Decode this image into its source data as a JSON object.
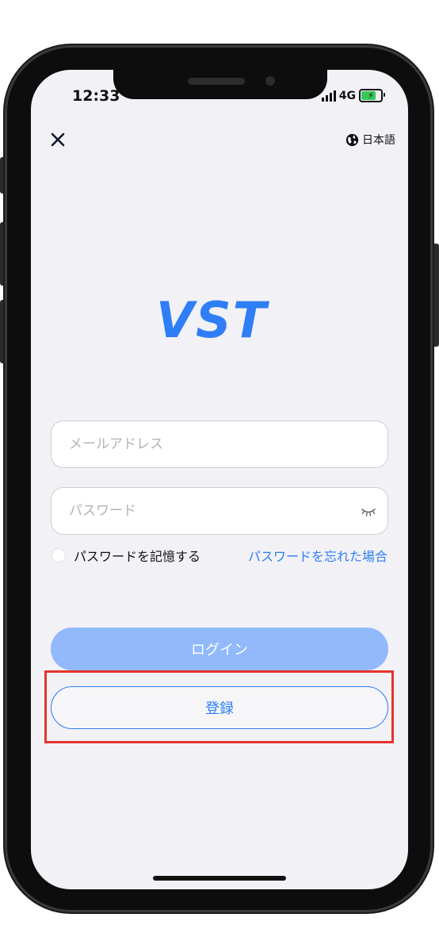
{
  "status_bar": {
    "time": "12:33",
    "network": "4G"
  },
  "header": {
    "close_icon": "close-icon",
    "language_icon": "globe-icon",
    "language_label": "日本語"
  },
  "logo": {
    "text": "VST",
    "color": "#2f7ef5"
  },
  "form": {
    "email_placeholder": "メールアドレス",
    "email_value": "",
    "password_placeholder": "パスワード",
    "password_value": "",
    "password_toggle_icon": "eye-closed-icon",
    "remember_label": "パスワードを記憶する",
    "remember_checked": false,
    "forgot_label": "パスワードを忘れた場合"
  },
  "actions": {
    "login_label": "ログイン",
    "register_label": "登録"
  },
  "colors": {
    "accent": "#2f7ef5",
    "login_disabled": "#91b9fb",
    "highlight": "#e3342f",
    "screen_bg": "#f2f1f6"
  }
}
